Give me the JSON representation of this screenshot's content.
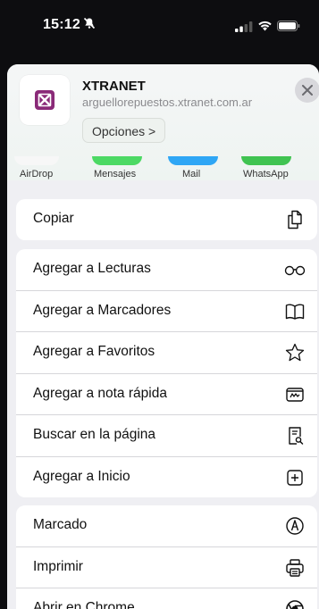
{
  "status_bar": {
    "time": "15:12"
  },
  "site": {
    "title": "XTRANET",
    "url": "arguellorepuestos.xtranet.com.ar",
    "options_label": "Opciones >"
  },
  "apps": [
    {
      "label": "AirDrop",
      "color": "#f3f3f3"
    },
    {
      "label": "Mensajes",
      "color": "#4cd964"
    },
    {
      "label": "Mail",
      "color": "#2fa6f5"
    },
    {
      "label": "WhatsApp",
      "color": "#40c351"
    }
  ],
  "actions": {
    "copy": {
      "label": "Copiar",
      "icon": "copy-icon"
    },
    "group2": [
      {
        "label": "Agregar a Lecturas",
        "icon": "glasses-icon"
      },
      {
        "label": "Agregar a Marcadores",
        "icon": "book-icon"
      },
      {
        "label": "Agregar a Favoritos",
        "icon": "star-icon"
      },
      {
        "label": "Agregar a nota rápida",
        "icon": "quick-note-icon"
      },
      {
        "label": "Buscar en la página",
        "icon": "find-in-page-icon"
      },
      {
        "label": "Agregar a Inicio",
        "icon": "add-square-icon"
      }
    ],
    "group3": [
      {
        "label": "Marcado",
        "icon": "markup-icon"
      },
      {
        "label": "Imprimir",
        "icon": "printer-icon"
      },
      {
        "label": "Abrir en Chrome",
        "icon": "chrome-icon"
      }
    ]
  }
}
